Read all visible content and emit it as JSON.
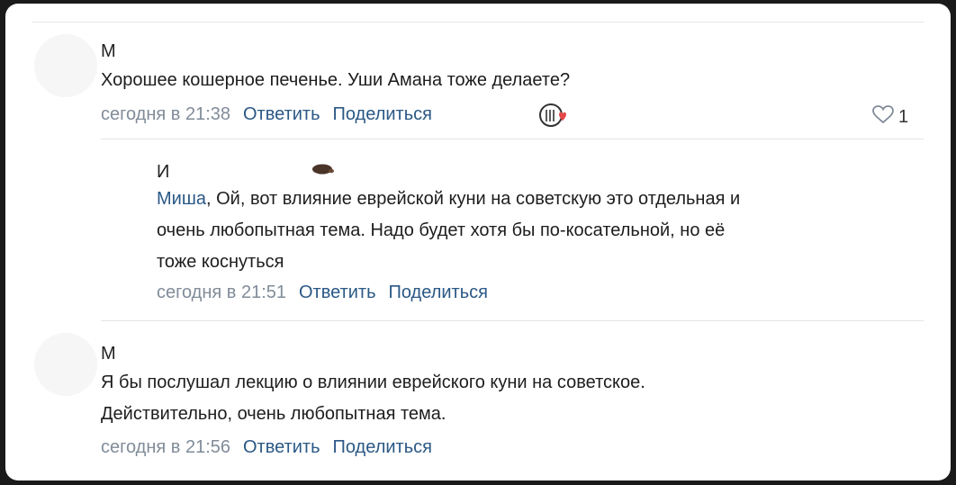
{
  "comments": [
    {
      "author": "М",
      "text": "Хорошее кошерное печенье. Уши Амана тоже делаете?",
      "time": "сегодня в 21:38",
      "reply_label": "Ответить",
      "share_label": "Поделиться",
      "likes": "1"
    },
    {
      "author": "И",
      "mention": "Миша",
      "text_line1": ", Ой, вот влияние еврейской куни на советскую это отдельная и",
      "text_line2": "очень любопытная тема. Надо будет хотя бы по-косательной, но её",
      "text_line3": "тоже коснуться",
      "time": "сегодня в 21:51",
      "reply_label": "Ответить",
      "share_label": "Поделиться"
    },
    {
      "author": "М",
      "text_line1": "Я бы послушал лекцию о влиянии еврейского куни на советское.",
      "text_line2": "Действительно, очень любопытная тема.",
      "time": "сегодня в 21:56",
      "reply_label": "Ответить",
      "share_label": "Поделиться"
    }
  ],
  "colors": {
    "link": "#2a5885",
    "meta": "#818c99",
    "text": "#1d1d1f",
    "divider": "#e3e4e8",
    "heart": "#e64646"
  },
  "icons": [
    "reaction-icon",
    "like-icon",
    "hedgehog-emoji-icon"
  ]
}
